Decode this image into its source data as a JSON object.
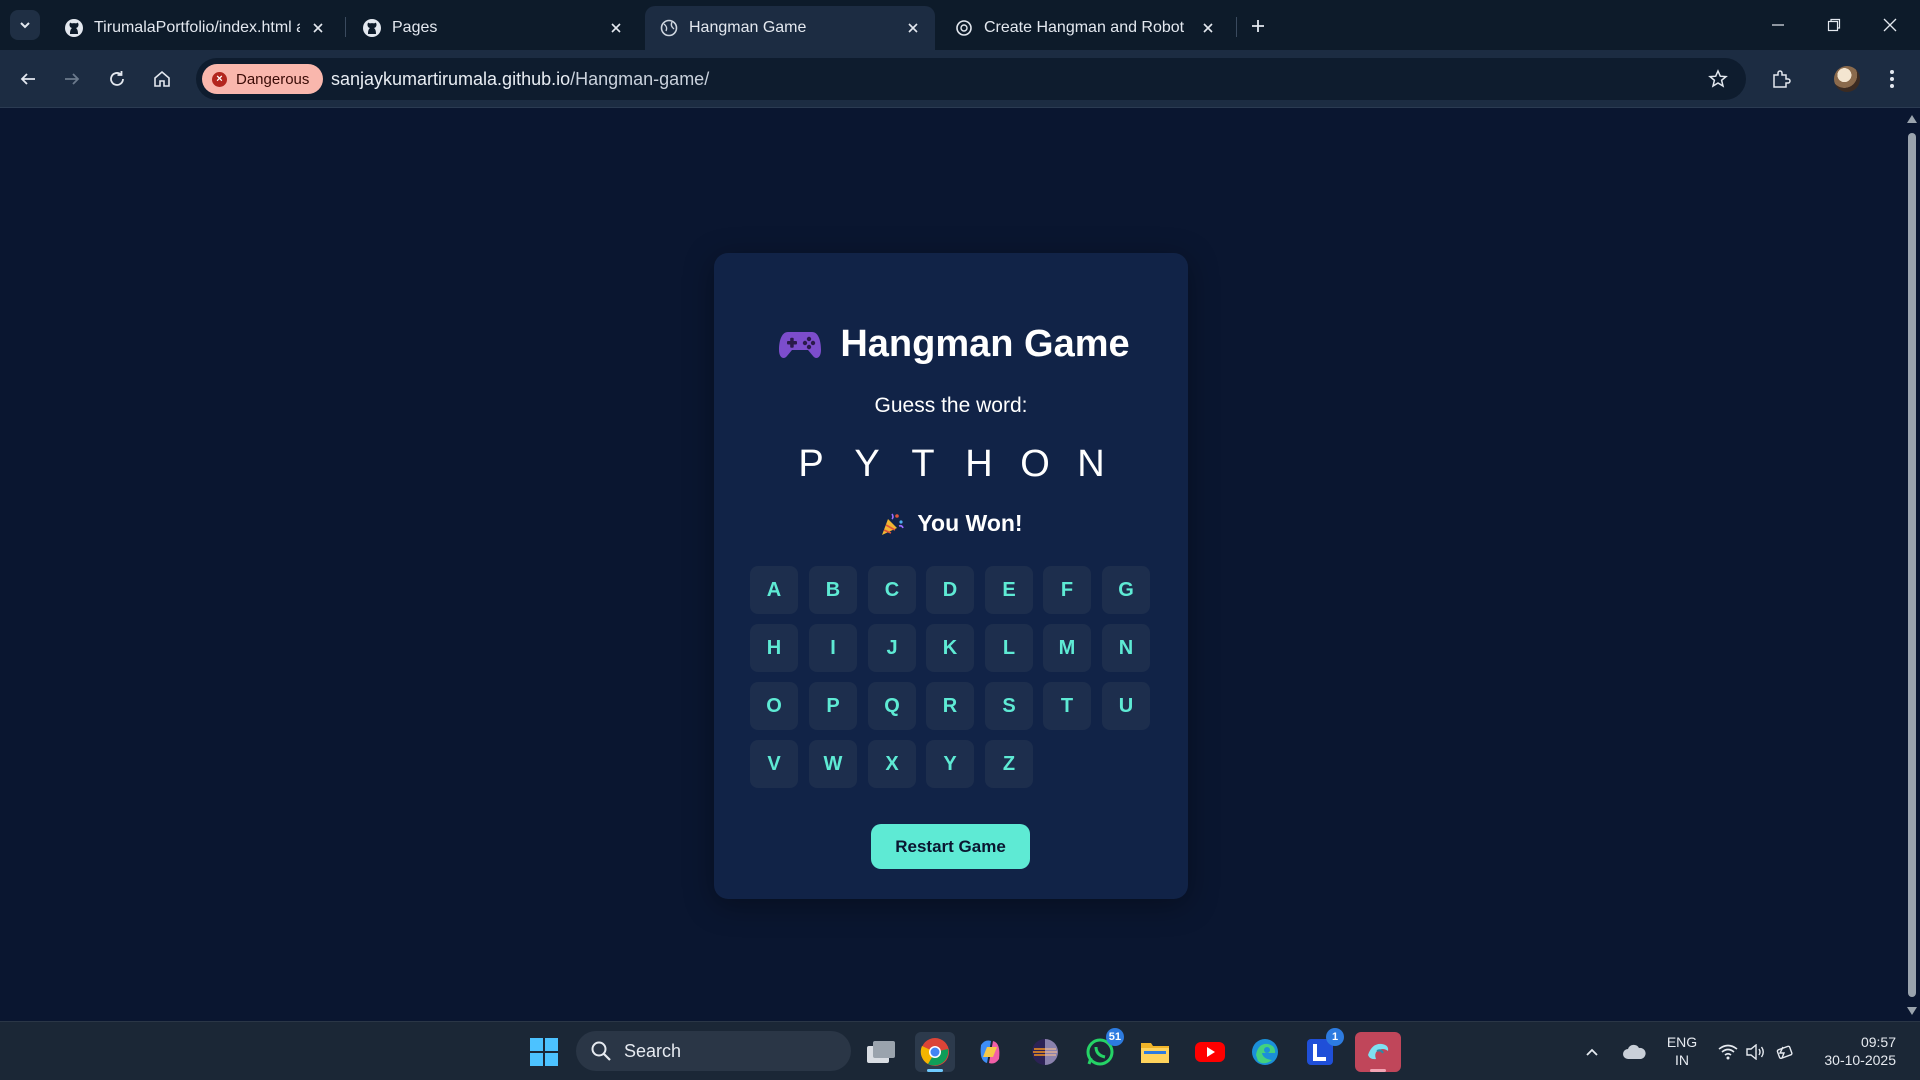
{
  "browser": {
    "tabs": [
      {
        "title": "TirumalaPortfolio/index.html at",
        "icon": "github-icon",
        "active": false
      },
      {
        "title": "Pages",
        "icon": "github-icon",
        "active": false
      },
      {
        "title": "Hangman Game",
        "icon": "globe-icon",
        "active": true
      },
      {
        "title": "Create Hangman and Robot",
        "icon": "chatgpt-icon",
        "active": false
      }
    ],
    "security_chip": "Dangerous",
    "url_host": "sanjaykumartirumala.github.io",
    "url_path": "/Hangman-game/"
  },
  "game": {
    "title": "Hangman Game",
    "title_icon": "gamepad-icon",
    "subtitle": "Guess the word:",
    "word": [
      "P",
      "Y",
      "T",
      "H",
      "O",
      "N"
    ],
    "status": "You Won!",
    "status_icon": "party-popper-icon",
    "keys": [
      "A",
      "B",
      "C",
      "D",
      "E",
      "F",
      "G",
      "H",
      "I",
      "J",
      "K",
      "L",
      "M",
      "N",
      "O",
      "P",
      "Q",
      "R",
      "S",
      "T",
      "U",
      "V",
      "W",
      "X",
      "Y",
      "Z"
    ],
    "restart_label": "Restart Game"
  },
  "colors": {
    "page_bg": "#0a1630",
    "card_bg": "#112347",
    "key_bg": "#1d2e4d",
    "accent": "#5eead4",
    "danger_chip": "#f9b7ad"
  },
  "taskbar": {
    "search_placeholder": "Search",
    "apps": [
      {
        "name": "task-view-icon"
      },
      {
        "name": "chrome-icon",
        "active": true
      },
      {
        "name": "copilot-icon"
      },
      {
        "name": "eclipse-icon"
      },
      {
        "name": "whatsapp-icon",
        "badge": "51"
      },
      {
        "name": "file-explorer-icon"
      },
      {
        "name": "youtube-icon"
      },
      {
        "name": "edge-icon"
      },
      {
        "name": "lens-app-icon",
        "badge": "1"
      },
      {
        "name": "wave-app-icon"
      }
    ],
    "language_line1": "ENG",
    "language_line2": "IN",
    "time": "09:57",
    "date": "30-10-2025"
  }
}
